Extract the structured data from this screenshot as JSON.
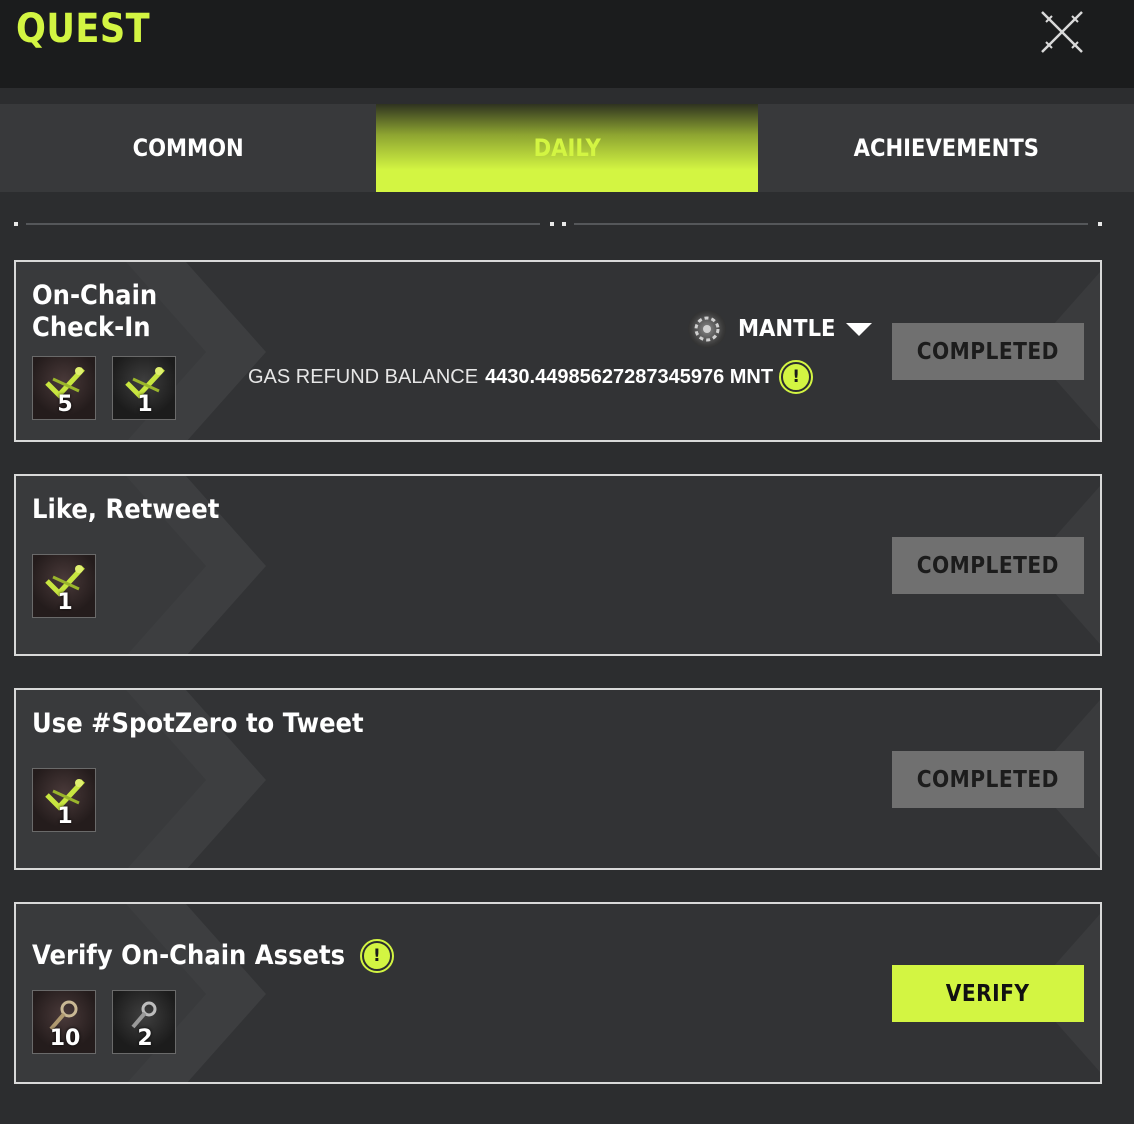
{
  "header": {
    "title": "QUEST",
    "close_icon": "close-icon"
  },
  "tabs": [
    {
      "label": "COMMON",
      "active": false
    },
    {
      "label": "DAILY",
      "active": true
    },
    {
      "label": "ACHIEVEMENTS",
      "active": false
    }
  ],
  "colors": {
    "accent": "#d3f542",
    "completed_bg": "#707070",
    "card_border": "#d9d9d9",
    "header_bg": "#1b1c1d"
  },
  "quests": [
    {
      "title": "On-Chain Check-In",
      "rewards": [
        {
          "icon": "key-icon",
          "count": "5"
        },
        {
          "icon": "key-icon",
          "count": "1"
        }
      ],
      "network": {
        "icon": "mantle-logo-icon",
        "name": "MANTLE",
        "dropdown_icon": "caret-down-icon"
      },
      "gas": {
        "label": "GAS REFUND BALANCE",
        "value": "4430.44985627287345976 MNT",
        "info_icon": "info-icon"
      },
      "status": "COMPLETED"
    },
    {
      "title": "Like, Retweet",
      "rewards": [
        {
          "icon": "key-icon",
          "count": "1"
        }
      ],
      "status": "COMPLETED"
    },
    {
      "title": "Use #SpotZero to Tweet",
      "rewards": [
        {
          "icon": "key-icon",
          "count": "1"
        }
      ],
      "status": "COMPLETED"
    },
    {
      "title": "Verify On-Chain Assets",
      "info_icon": "info-icon",
      "rewards": [
        {
          "icon": "wrench-icon",
          "count": "10"
        },
        {
          "icon": "wrench-icon",
          "count": "2"
        }
      ],
      "status": "VERIFY"
    }
  ]
}
